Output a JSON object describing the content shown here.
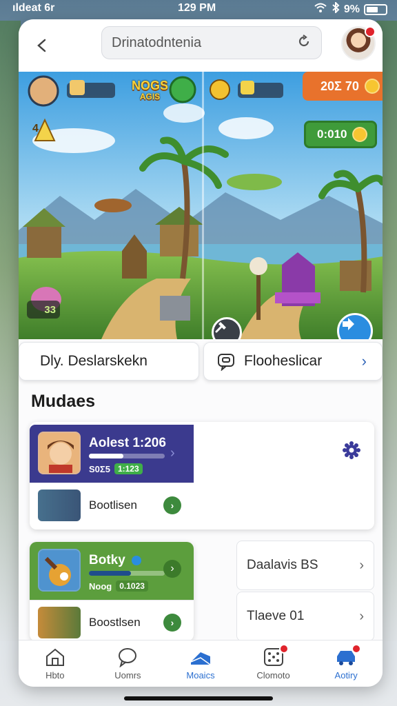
{
  "status_bar": {
    "carrier": "ıldeat 6r",
    "time": "129 PM",
    "battery": "9%"
  },
  "top_bar": {
    "search_value": "Drinatodntenia"
  },
  "game": {
    "logo": "NOGS",
    "logo_sub": "AGIS",
    "coin_badge": "20Σ 70",
    "timer_badge": "0:010",
    "level_badge": "33",
    "level_number": "4"
  },
  "actions": {
    "left_label": "Dly. Deslarskekn",
    "right_label": "Flooheslicar"
  },
  "section_title": "Mudaes",
  "modules": {
    "first": {
      "title": "Aolest 1:206",
      "sub": "S0Σ5",
      "sub_pill": "1:123",
      "progress": 0.45,
      "row_label": "Bootlisen"
    },
    "second": {
      "title": "Botky",
      "sub": "Nᴏog",
      "sub_pill": "0.1023",
      "progress": 0.55,
      "row_label": "Boostlsen"
    }
  },
  "side_list": [
    {
      "label": "Daalavis BS"
    },
    {
      "label": "Tlaeve 01"
    }
  ],
  "tabs": [
    {
      "label": "Hbto",
      "icon": "home-icon"
    },
    {
      "label": "Uomrs",
      "icon": "chat-bubble-icon"
    },
    {
      "label": "Moaics",
      "icon": "book-icon",
      "active": true
    },
    {
      "label": "Clomoto",
      "icon": "dice-icon"
    },
    {
      "label": "Aotiry",
      "icon": "car-icon"
    }
  ],
  "colors": {
    "accent": "#2b6fd0",
    "module_purple": "#3b3a8e",
    "module_green": "#5c9e3d",
    "coin_orange": "#e8722c",
    "timer_green": "#3f9b3a"
  }
}
